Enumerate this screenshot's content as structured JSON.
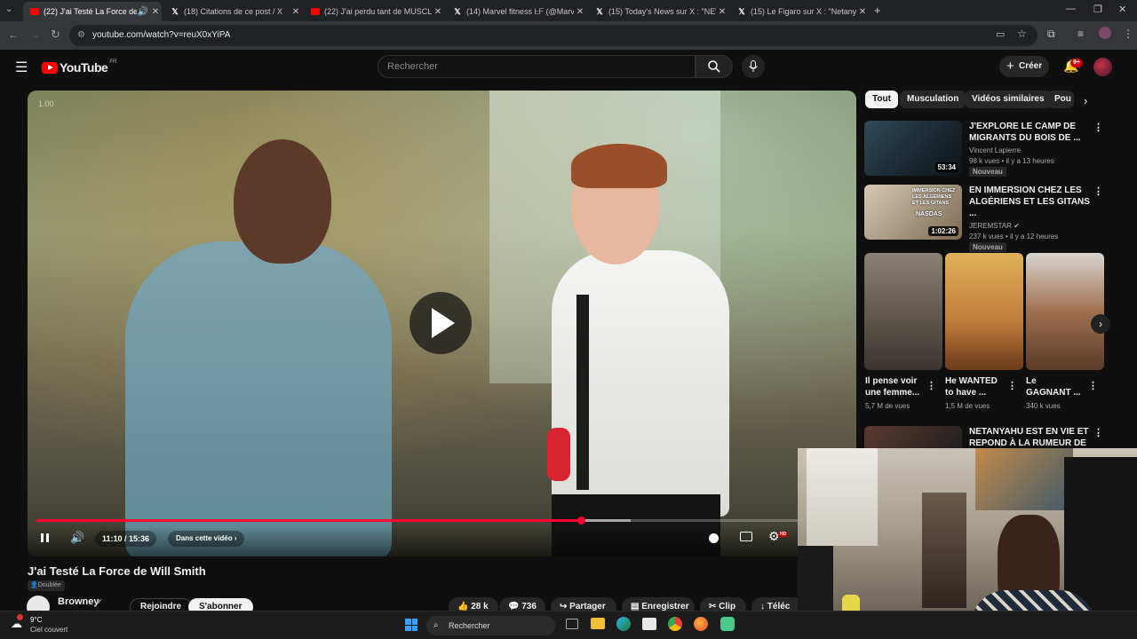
{
  "browser": {
    "tabs": [
      {
        "label": "(22) J'ai Testé La Force de W",
        "icon": "youtube-icon",
        "active": true
      },
      {
        "label": "(18) Citations de ce post / X",
        "icon": "x-icon",
        "active": false
      },
      {
        "label": "(22) J'ai perdu tant de MUSCLE",
        "icon": "youtube-icon",
        "active": false
      },
      {
        "label": "(14) Marvel fitness ᖶᖴ (@Marvel",
        "icon": "x-icon",
        "active": false
      },
      {
        "label": "(15) Today's News sur X : \"NEW",
        "icon": "x-icon",
        "active": false
      },
      {
        "label": "(15) Le Figaro sur X : \"Netanyal",
        "icon": "x-icon",
        "active": false
      }
    ],
    "url": "youtube.com/watch?v=reuX0xYiPA"
  },
  "youtube": {
    "logo_text": "YouTube",
    "region": "FR",
    "search_placeholder": "Rechercher",
    "create_label": "Créer",
    "notif_count": "9+"
  },
  "player": {
    "speed_label": "1.00",
    "time": "11:10 / 15:36",
    "chapter": "Dans cette vidéo",
    "progress": 0.715,
    "buffered": 0.78
  },
  "video_info": {
    "title": "J'ai Testé La Force de Will Smith",
    "dubbed": "Doublée",
    "channel": "Browney",
    "join": "Rejoindre",
    "subscribe": "S'abonner",
    "likes": "28 k",
    "comments": "736",
    "share": "Partager",
    "save": "Enregistrer",
    "clip": "Clip",
    "download": "Téléc"
  },
  "chips": [
    "Tout",
    "Musculation",
    "Vidéos similaires",
    "Pou"
  ],
  "recommendations": [
    {
      "title1": "J'EXPLORE LE CAMP DE",
      "title2": "MIGRANTS DU BOIS DE ...",
      "channel": "Vincent Lapierre",
      "meta": "98 k vues • il y a 13 heures",
      "badge": "Nouveau",
      "duration": "53:34"
    },
    {
      "title1": "EN IMMERSION CHEZ LES",
      "title2": "ALGÉRIENS ET LES GITANS ...",
      "channel": "JEREMSTAR",
      "meta": "237 k vues • il y a 12 heures",
      "badge": "Nouveau",
      "duration": "1:02:26",
      "thumb_text": "IMMERSION CHEZ LES ALGÉRIENS ET LES GITANS",
      "thumb_tag": "NASDAS"
    }
  ],
  "shorts": [
    {
      "title1": "Il pense voir",
      "title2": "une femme...",
      "views": "5,7 M de vues"
    },
    {
      "title1": "He WANTED",
      "title2": "to have ...",
      "views": "1,5 M de vues"
    },
    {
      "title1": "Le",
      "title2": "GAGNANT ...",
      "views": "340 k vues"
    }
  ],
  "rec_next": {
    "title1": "NETANYAHU EST EN VIE ET",
    "title2": "REPOND À LA RUMEUR DE SA ..."
  },
  "taskbar": {
    "temp": "9°C",
    "weather": "Ciel couvert",
    "search": "Rechercher"
  }
}
